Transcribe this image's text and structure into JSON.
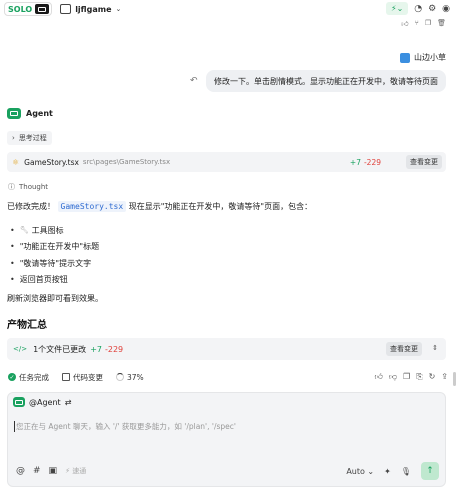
{
  "topbar": {
    "solo_label": "SOLO",
    "project_name": "ljflgame",
    "icons": [
      "bolt-icon",
      "chat-icon",
      "gear-icon",
      "account-icon"
    ]
  },
  "user": {
    "name": "山边小草"
  },
  "user_message": "修改一下。单击剧情模式。显示功能正在开发中，敬请等待页面",
  "agent": {
    "name": "Agent"
  },
  "thinking": {
    "label": "思考过程"
  },
  "file_change": {
    "filename": "GameStory.tsx",
    "path": "src\\pages\\GameStory.tsx",
    "added": "+7",
    "removed": "-229",
    "view_label": "查看变更"
  },
  "thought_label": "Thought",
  "response": {
    "prefix": "已修改完成！",
    "code": "GameStory.tsx",
    "suffix": " 现在显示\"功能正在开发中，敬请等待\"页面，包含：",
    "bullets": [
      "工具图标",
      "\"功能正在开发中\"标题",
      "\"敬请等待\"提示文字",
      "返回首页按钮"
    ],
    "refresh": "刷新浏览器即可看到效果。"
  },
  "product": {
    "heading": "产物汇总",
    "files_changed": "1个文件已更改",
    "added": "+7",
    "removed": "-229",
    "view_label": "查看变更"
  },
  "status": {
    "task_done": "任务完成",
    "code_change": "代码变更",
    "progress": "37%"
  },
  "composer": {
    "agent_chip": "@Agent",
    "placeholder": "您正在与 Agent 聊天，输入 '/' 获取更多能力，如 '/plan', '/spec'",
    "speed": "速通",
    "model": "Auto"
  }
}
